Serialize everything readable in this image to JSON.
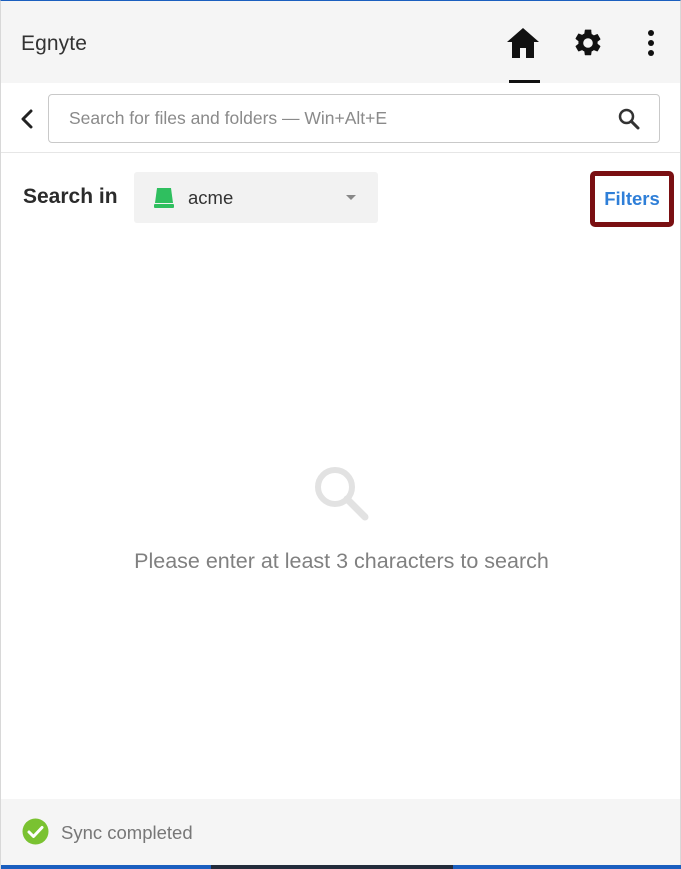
{
  "header": {
    "title": "Egnyte",
    "buttons": [
      {
        "name": "home",
        "icon": "home-icon",
        "active": true
      },
      {
        "name": "settings",
        "icon": "gear-icon"
      },
      {
        "name": "more",
        "icon": "more-vertical-icon"
      }
    ]
  },
  "search": {
    "back_icon": "chevron-left-icon",
    "placeholder": "Search for files and folders — Win+Alt+E",
    "value": "",
    "icon": "search-icon"
  },
  "scope": {
    "label": "Search in",
    "selected": "acme",
    "drive_icon": "drive-icon",
    "drive_color": "#2fbf5f",
    "filters_label": "Filters",
    "filters_color": "#2f7fd8",
    "highlight_color": "#7a0f12"
  },
  "empty_state": {
    "icon": "search-icon",
    "message": "Please enter at least 3 characters to search"
  },
  "footer": {
    "status_icon": "check-circle-icon",
    "status_color": "#7ac231",
    "status_text": "Sync completed"
  }
}
